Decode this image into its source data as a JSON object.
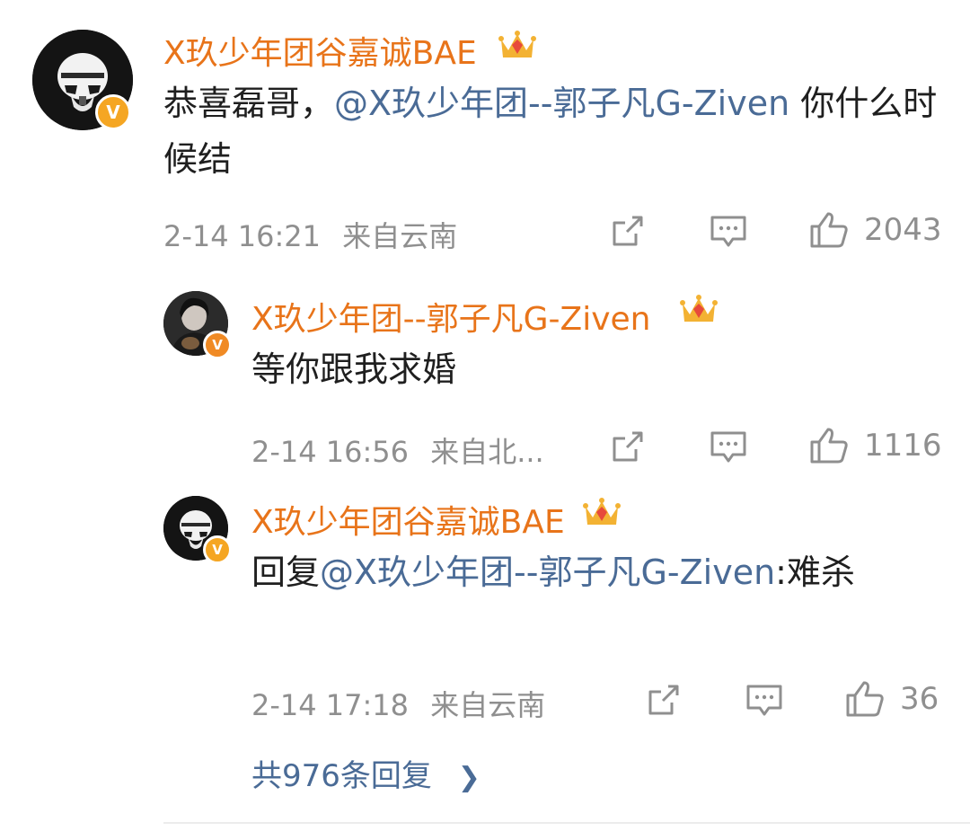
{
  "colors": {
    "username": "#e8741a",
    "mention": "#4a6b96",
    "meta": "#8f8f8f",
    "verified": "#f5a623"
  },
  "comments": [
    {
      "username": "X玖少年团谷嘉诚BAE",
      "text_prefix": "恭喜磊哥，",
      "mention": "@X玖少年团--郭子凡G-Ziven",
      "text_suffix": " 你什么时候结",
      "time": "2-14 16:21",
      "location": "来自云南",
      "likes": "2043",
      "avatar_icon": "stormtrooper-avatar"
    },
    {
      "username": "X玖少年团--郭子凡G-Ziven",
      "text_prefix": "等你跟我求婚",
      "mention": "",
      "text_suffix": "",
      "time": "2-14 16:56",
      "location": "来自北...",
      "likes": "1116",
      "avatar_icon": "portrait-avatar"
    },
    {
      "username": "X玖少年团谷嘉诚BAE",
      "text_prefix": "回复",
      "mention": "@X玖少年团--郭子凡G-Ziven",
      "text_suffix": ":难杀",
      "time": "2-14 17:18",
      "location": "来自云南",
      "likes": "36",
      "avatar_icon": "stormtrooper-avatar"
    }
  ],
  "more_replies": "共976条回复",
  "more_replies_icon": "chevron-right-icon",
  "verified_badge_letter": "V"
}
